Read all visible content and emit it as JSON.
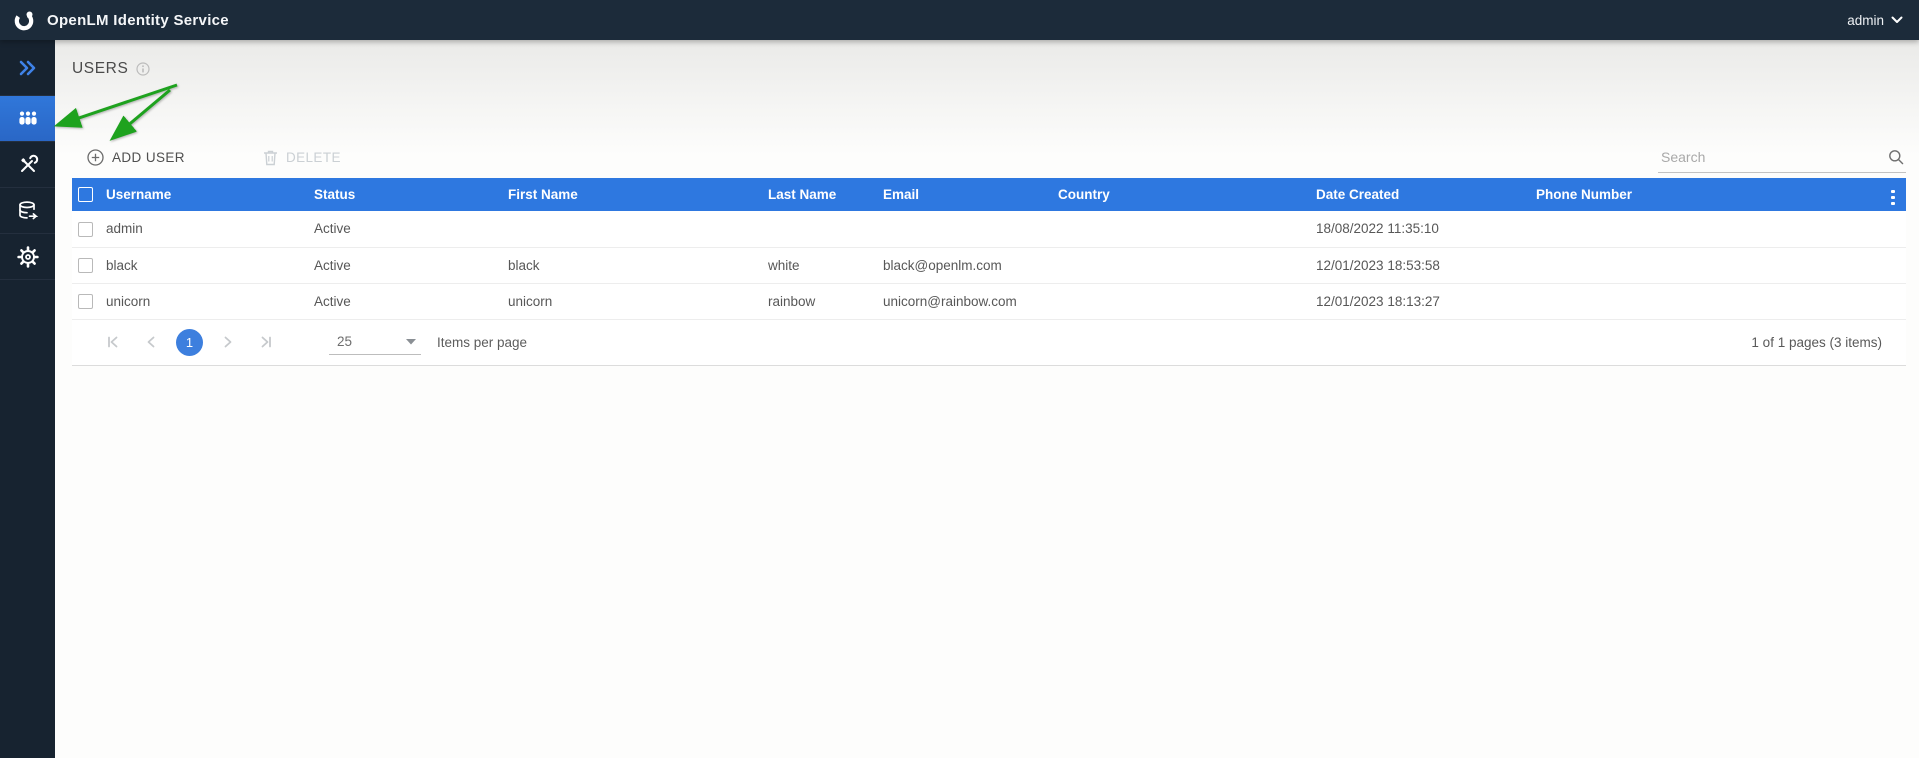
{
  "topbar": {
    "title": "OpenLM Identity Service",
    "user_menu": "admin",
    "logo_icon": "openlm-logo-icon",
    "user_chevron_icon": "chevron-down-icon"
  },
  "sidebar": {
    "items": [
      {
        "icon": "double-chevron-right-icon",
        "active": false
      },
      {
        "icon": "users-icon",
        "active": true
      },
      {
        "icon": "tools-icon",
        "active": false
      },
      {
        "icon": "database-icon",
        "active": false
      },
      {
        "icon": "gear-icon",
        "active": false
      }
    ]
  },
  "page": {
    "title": "USERS",
    "info_icon": "info-icon"
  },
  "toolbar": {
    "add_user_label": "ADD USER",
    "add_icon": "circle-plus-icon",
    "delete_label": "DELETE",
    "delete_icon": "trash-icon",
    "search_placeholder": "Search",
    "search_icon": "magnifier-icon"
  },
  "table": {
    "menu_icon": "kebab-menu-icon",
    "columns": [
      "Username",
      "Status",
      "First Name",
      "Last Name",
      "Email",
      "Country",
      "Date Created",
      "Phone Number"
    ],
    "rows": [
      {
        "username": "admin",
        "status": "Active",
        "first_name": "",
        "last_name": "",
        "email": "",
        "country": "",
        "date_created": "18/08/2022 11:35:10",
        "phone_number": ""
      },
      {
        "username": "black",
        "status": "Active",
        "first_name": "black",
        "last_name": "white",
        "email": "black@openlm.com",
        "country": "",
        "date_created": "12/01/2023 18:53:58",
        "phone_number": ""
      },
      {
        "username": "unicorn",
        "status": "Active",
        "first_name": "unicorn",
        "last_name": "rainbow",
        "email": "unicorn@rainbow.com",
        "country": "",
        "date_created": "12/01/2023 18:13:27",
        "phone_number": ""
      }
    ]
  },
  "pagination": {
    "first_icon": "page-first-icon",
    "prev_icon": "page-prev-icon",
    "next_icon": "page-next-icon",
    "last_icon": "page-last-icon",
    "current_page": "1",
    "page_size": "25",
    "items_per_page_label": "Items per page",
    "summary": "1 of 1 pages (3 items)"
  },
  "annotation": {
    "type": "green-arrows",
    "targets": "users-nav-icon and add-user-button",
    "color": "#1ea21e"
  },
  "colors": {
    "topbar_bg": "#1c2b3a",
    "sidebar_bg": "#172330",
    "sidebar_active_bg": "#2e73d4",
    "table_header_bg": "#2e78e0",
    "pager_active_bg": "#3d7fde",
    "annotation_green": "#1ea21e"
  }
}
